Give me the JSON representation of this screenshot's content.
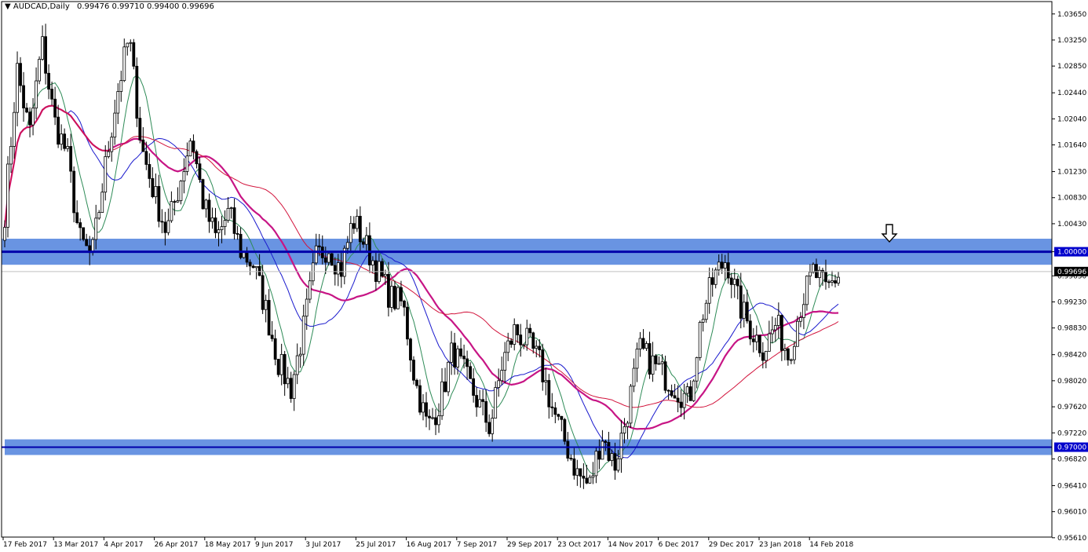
{
  "chart_header": {
    "symbol": "AUDCAD,Daily",
    "ohlc": "0.99476 0.99710 0.99400 0.99696",
    "dropdown_glyph": "▼"
  },
  "chart_data": {
    "type": "candlestick",
    "symbol": "AUDCAD",
    "timeframe": "Daily",
    "ylim": [
      0.9562,
      1.0384
    ],
    "yticks": [
      "1.03650",
      "1.03250",
      "1.02850",
      "1.02440",
      "1.02040",
      "1.01640",
      "1.01230",
      "1.00830",
      "1.00430",
      "1.00000",
      "0.99630",
      "0.99230",
      "0.98830",
      "0.98420",
      "0.98020",
      "0.97620",
      "0.97220",
      "0.96820",
      "0.96410",
      "0.96010",
      "0.95610"
    ],
    "xticks": [
      "17 Feb 2017",
      "13 Mar 2017",
      "4 Apr 2017",
      "26 Apr 2017",
      "18 May 2017",
      "9 Jun 2017",
      "3 Jul 2017",
      "25 Jul 2017",
      "16 Aug 2017",
      "7 Sep 2017",
      "29 Sep 2017",
      "23 Oct 2017",
      "14 Nov 2017",
      "6 Dec 2017",
      "29 Dec 2017",
      "23 Jan 2018",
      "14 Feb 2018"
    ],
    "last_price": "0.99696",
    "levels": [
      {
        "price": 1.0,
        "label": "1.00000",
        "zone": [
          0.998,
          1.002
        ]
      },
      {
        "price": 0.97,
        "label": "0.97000",
        "zone": [
          0.9688,
          0.9712
        ]
      }
    ],
    "annotations": [
      {
        "type": "down-arrow",
        "near_price": 1.002,
        "period": "late Feb 2018"
      }
    ],
    "moving_averages": [
      {
        "color": "#2e8b57"
      },
      {
        "color": "#1a1acd"
      },
      {
        "color": "#c71585"
      },
      {
        "color": "#d2143c"
      }
    ],
    "series_anchors": [
      1.006,
      1.028,
      1.018,
      1.032,
      1.02,
      1.015,
      1.002,
      0.999,
      1.012,
      1.024,
      1.033,
      1.016,
      1.009,
      1.003,
      1.01,
      1.018,
      1.007,
      1.002,
      1.006,
      1.0,
      0.998,
      0.991,
      0.983,
      0.979,
      0.988,
      0.999,
      1.001,
      0.997,
      1.005,
      1.001,
      0.997,
      0.993,
      0.992,
      0.98,
      0.973,
      0.977,
      0.985,
      0.981,
      0.977,
      0.973,
      0.983,
      0.988,
      0.986,
      0.983,
      0.976,
      0.971,
      0.966,
      0.964,
      0.972,
      0.967,
      0.975,
      0.985,
      0.983,
      0.981,
      0.979,
      0.977,
      0.99,
      0.996,
      0.999,
      0.992,
      0.988,
      0.985,
      0.989,
      0.984,
      0.992,
      0.997,
      0.994,
      0.9965
    ],
    "candle_count": 266,
    "wick_range_avg": 0.0036,
    "seed": 7
  },
  "colors": {
    "bull": "#ffffff",
    "bear": "#000000",
    "outline": "#000000",
    "zone": "#4f81dd",
    "level_line": "#0000aa",
    "label_bg": "#0000cc",
    "last_price_bg": "#000000",
    "gridline": "#c0c0c0"
  }
}
